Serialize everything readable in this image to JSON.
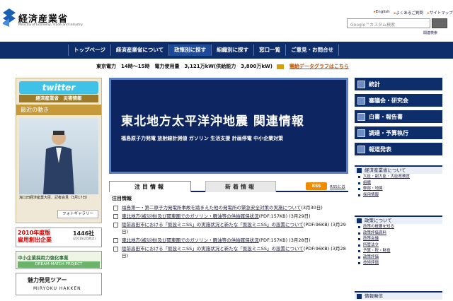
{
  "header": {
    "title": "経済産業省",
    "subtitle": "Ministry of Economy, Trade and Industry",
    "top_links": [
      "English",
      "よくあるご質問",
      "サイトマップ"
    ],
    "search_placeholder": "Google™カスタム検索",
    "search_link": "関連検索"
  },
  "nav": {
    "items": [
      "トップページ",
      "経済産業省について",
      "政策別に探す",
      "組織別に探す",
      "窓口一覧",
      "ご意見・お問合せ"
    ]
  },
  "power": {
    "text": "東京電力　14時～15時　電力使用量　3,121万kW(供給能力　3,800万kW)",
    "link": "需給データグラフはこちら"
  },
  "twitter": {
    "logo": "twitter",
    "subtitle": "経済産業省　災害情報",
    "recent": "最近の動き",
    "caption": "海江田経済産業大臣、記者会見（3月17日）",
    "photo_gallery": "フォトギャラリー"
  },
  "banners": {
    "b1_left": "2010年度版",
    "b1_left2": "雇用創出企業",
    "b1_count": "1446社",
    "b1_note": "(2011年2月時点)",
    "b2_top": "中小企業採用力強化事業",
    "b2_bot": "DREAM-MATCH PROJECT",
    "b3_top": "魅力発見ツアー",
    "b3_bot": "MIRYOKU HAKKEN"
  },
  "hero": {
    "title": "東北地方太平洋沖地震 関連情報",
    "subtitle": "福島原子力発電 放射線計測値 ガソリン 生活支援 計画停電 中小企業対策"
  },
  "tabs": {
    "active": "注目情報",
    "inactive": "新着情報",
    "rss": "RSS",
    "rss_link": "RSSとは"
  },
  "news": {
    "heading": "注目情報",
    "items": [
      {
        "link": "福島第一・第二原子力発電所事故を踏まえた他の発電所の緊急安全対策の実施について",
        "tail": "(3月30日)"
      },
      {
        "link": "東北地方(被災地)及び関東圏でのガソリン・軽油等の供給確保状況",
        "tail": "(PDF:157KB)  (3月29日)"
      },
      {
        "link": "陸前高田市における「仮設ミニSS」の実施状況と新たな「仮設ミニSS」の設置について",
        "tail": "(PDF:96KB)  (3月29日)"
      },
      {
        "link": "東北地方(被災地)及び関東圏でのガソリン・軽油等の供給確保状況",
        "tail": "(PDF:157KB)  (3月28日)"
      },
      {
        "link": "陸前高田市における「仮設ミニSS」の実施状況と新たな「仮設ミニSS」の設置について",
        "tail": "(PDF:96KB)  (3月28日)"
      }
    ]
  },
  "right": {
    "menu": [
      "統計",
      "審議会・研究会",
      "白書・報告書",
      "調達・予算執行",
      "報道発表"
    ],
    "sec1_head": "経済産業省について",
    "sec1_items": [
      "大臣・副大臣・大臣政務官",
      "組織",
      "幹部・地図",
      "採用情報"
    ],
    "sec2_head": "政策について",
    "sec2_items": [
      "政策の概要を知る",
      "政策評価資料",
      "政策会議",
      "所管法令",
      "予算・税・財投",
      "政策評価",
      "技術評価"
    ],
    "sec3_head": "情報発信"
  }
}
